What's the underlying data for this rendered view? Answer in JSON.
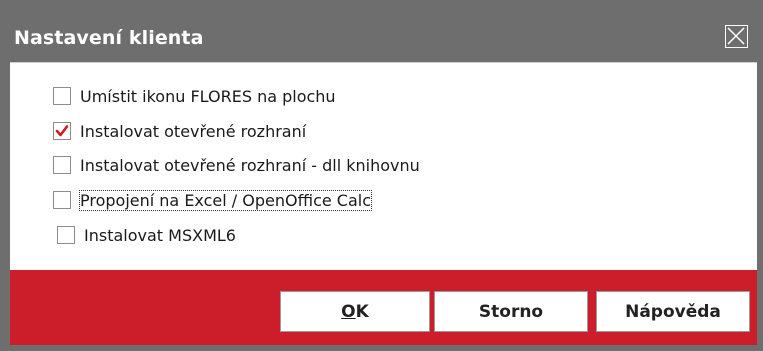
{
  "dialog": {
    "title": "Nastavení klienta",
    "close_icon": "close-icon"
  },
  "options": [
    {
      "label": "Umístit ikonu FLORES na plochu",
      "checked": false
    },
    {
      "label": "Instalovat otevřené rozhraní",
      "checked": true
    },
    {
      "label": "Instalovat otevřené rozhraní - dll knihovnu",
      "checked": false
    },
    {
      "label": "Propojení na Excel / OpenOffice Calc",
      "checked": false,
      "focused": true
    },
    {
      "label": "Instalovat MSXML6",
      "checked": false
    }
  ],
  "buttons": {
    "ok": {
      "mnemonic": "O",
      "rest": "K"
    },
    "cancel": "Storno",
    "help": "Nápověda"
  },
  "colors": {
    "title_bar": "#6e6e6e",
    "footer": "#cc1d2b",
    "check": "#cc1d2b"
  }
}
